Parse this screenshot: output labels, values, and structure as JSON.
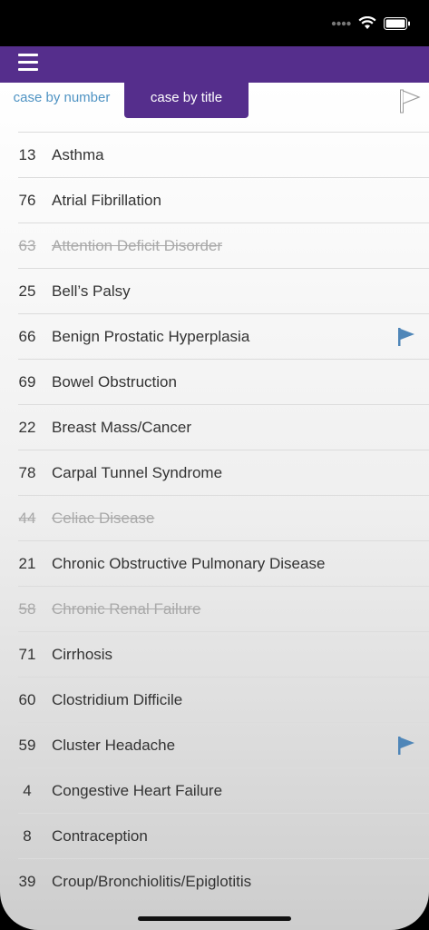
{
  "segments": {
    "by_number": "case by number",
    "by_title": "case by title"
  },
  "cases": [
    {
      "number": "13",
      "title": "Asthma",
      "done": false,
      "flagged": false
    },
    {
      "number": "76",
      "title": "Atrial Fibrillation",
      "done": false,
      "flagged": false
    },
    {
      "number": "63",
      "title": "Attention Deficit Disorder",
      "done": true,
      "flagged": false
    },
    {
      "number": "25",
      "title": "Bell’s Palsy",
      "done": false,
      "flagged": false
    },
    {
      "number": "66",
      "title": "Benign Prostatic Hyperplasia",
      "done": false,
      "flagged": true
    },
    {
      "number": "69",
      "title": "Bowel Obstruction",
      "done": false,
      "flagged": false
    },
    {
      "number": "22",
      "title": "Breast Mass/Cancer",
      "done": false,
      "flagged": false
    },
    {
      "number": "78",
      "title": "Carpal Tunnel Syndrome",
      "done": false,
      "flagged": false
    },
    {
      "number": "44",
      "title": "Celiac Disease",
      "done": true,
      "flagged": false
    },
    {
      "number": "21",
      "title": "Chronic Obstructive Pulmonary Disease",
      "done": false,
      "flagged": false
    },
    {
      "number": "58",
      "title": "Chronic Renal Failure",
      "done": true,
      "flagged": false
    },
    {
      "number": "71",
      "title": "Cirrhosis",
      "done": false,
      "flagged": false
    },
    {
      "number": "60",
      "title": "Clostridium Difficile",
      "done": false,
      "flagged": false
    },
    {
      "number": "59",
      "title": "Cluster Headache",
      "done": false,
      "flagged": true
    },
    {
      "number": "4",
      "title": "Congestive Heart Failure",
      "done": false,
      "flagged": false
    },
    {
      "number": "8",
      "title": "Contraception",
      "done": false,
      "flagged": false
    },
    {
      "number": "39",
      "title": "Croup/Bronchiolitis/Epiglotitis",
      "done": false,
      "flagged": false
    }
  ],
  "colors": {
    "brand": "#552e8c",
    "link": "#4f93c3",
    "flag": "#4f86b8",
    "done_text": "#a9a9a9"
  },
  "icons": {
    "menu": "hamburger-icon",
    "flag": "flag-icon",
    "flag_filter": "flag-outline-icon"
  }
}
